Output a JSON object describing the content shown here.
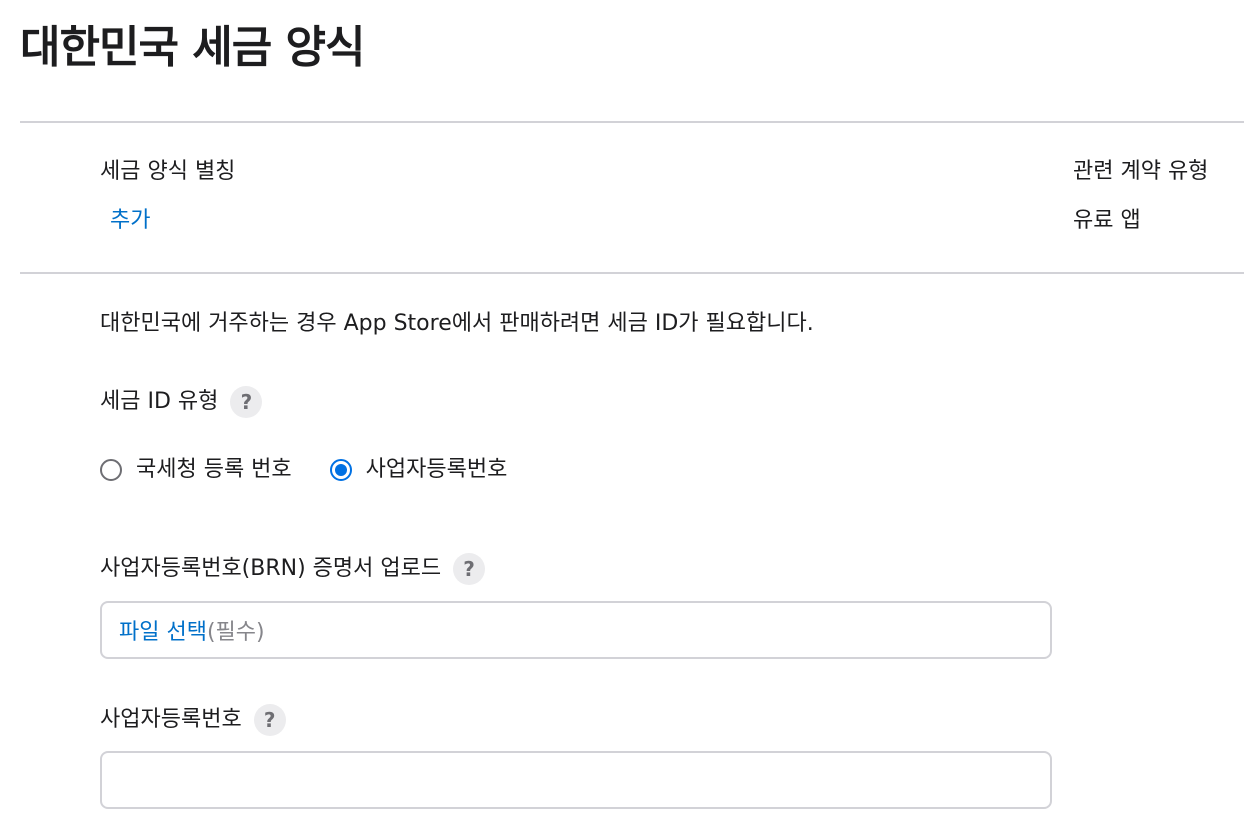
{
  "page": {
    "title": "대한민국 세금 양식"
  },
  "summary": {
    "alias_label": "세금 양식 별칭",
    "alias_action": "추가",
    "contract_type_label": "관련 계약 유형",
    "contract_type_value": "유료 앱"
  },
  "form": {
    "description": "대한민국에 거주하는 경우 App Store에서 판매하려면 세금 ID가 필요합니다.",
    "tax_id_type": {
      "label": "세금 ID 유형",
      "help": "?",
      "options": [
        {
          "label": "국세청 등록 번호",
          "selected": false
        },
        {
          "label": "사업자등록번호",
          "selected": true
        }
      ]
    },
    "brn_upload": {
      "label": "사업자등록번호(BRN) 증명서 업로드",
      "help": "?",
      "choose_file": "파일 선택",
      "required": "(필수)"
    },
    "brn_number": {
      "label": "사업자등록번호",
      "help": "?",
      "value": ""
    }
  },
  "colors": {
    "link": "#0070c9",
    "radio_selected": "#0071e3",
    "divider": "#d2d2d7"
  }
}
